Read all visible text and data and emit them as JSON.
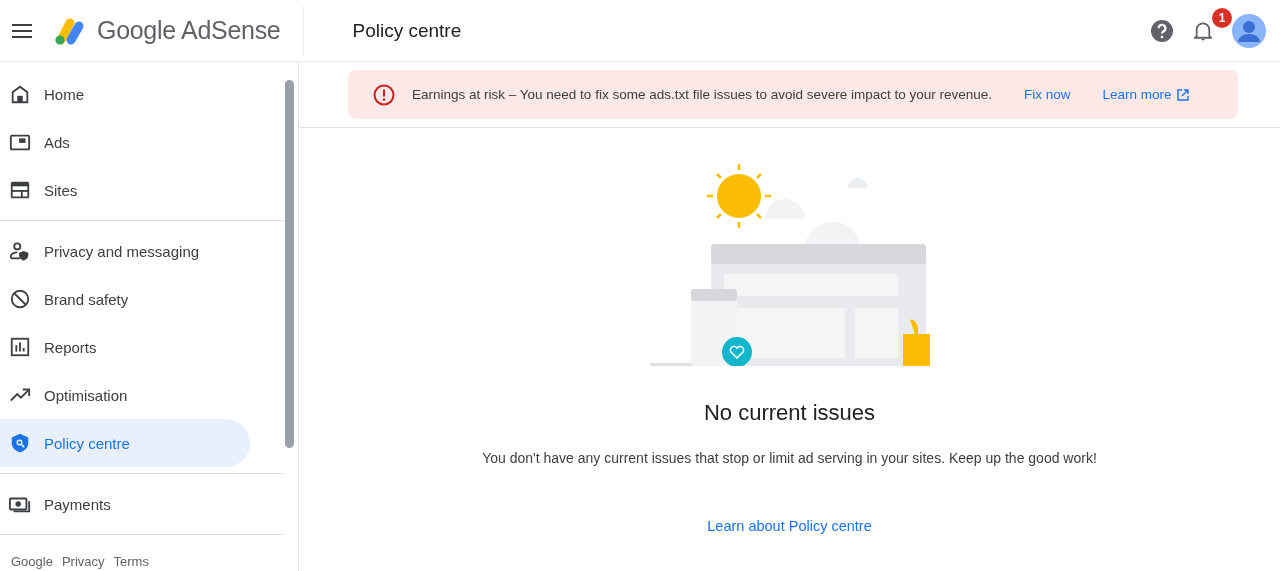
{
  "header": {
    "brand": "Google AdSense",
    "page_title": "Policy centre",
    "notification_count": "1"
  },
  "sidebar": {
    "groups": [
      [
        {
          "label": "Home",
          "selected": false
        },
        {
          "label": "Ads",
          "selected": false
        },
        {
          "label": "Sites",
          "selected": false
        }
      ],
      [
        {
          "label": "Privacy and messaging",
          "selected": false
        },
        {
          "label": "Brand safety",
          "selected": false
        },
        {
          "label": "Reports",
          "selected": false
        },
        {
          "label": "Optimisation",
          "selected": false
        },
        {
          "label": "Policy centre",
          "selected": true
        }
      ],
      [
        {
          "label": "Payments",
          "selected": false
        }
      ]
    ],
    "footer_links": [
      "Google",
      "Privacy",
      "Terms"
    ]
  },
  "alert": {
    "message": "Earnings at risk – You need to fix some ads.txt file issues to avoid severe impact to your revenue.",
    "actions": [
      "Fix now",
      "Learn more"
    ]
  },
  "empty_state": {
    "title": "No current issues",
    "message": "You don't have any current issues that stop or limit ad serving in your sites. Keep up the good work!",
    "link": "Learn about Policy centre"
  }
}
